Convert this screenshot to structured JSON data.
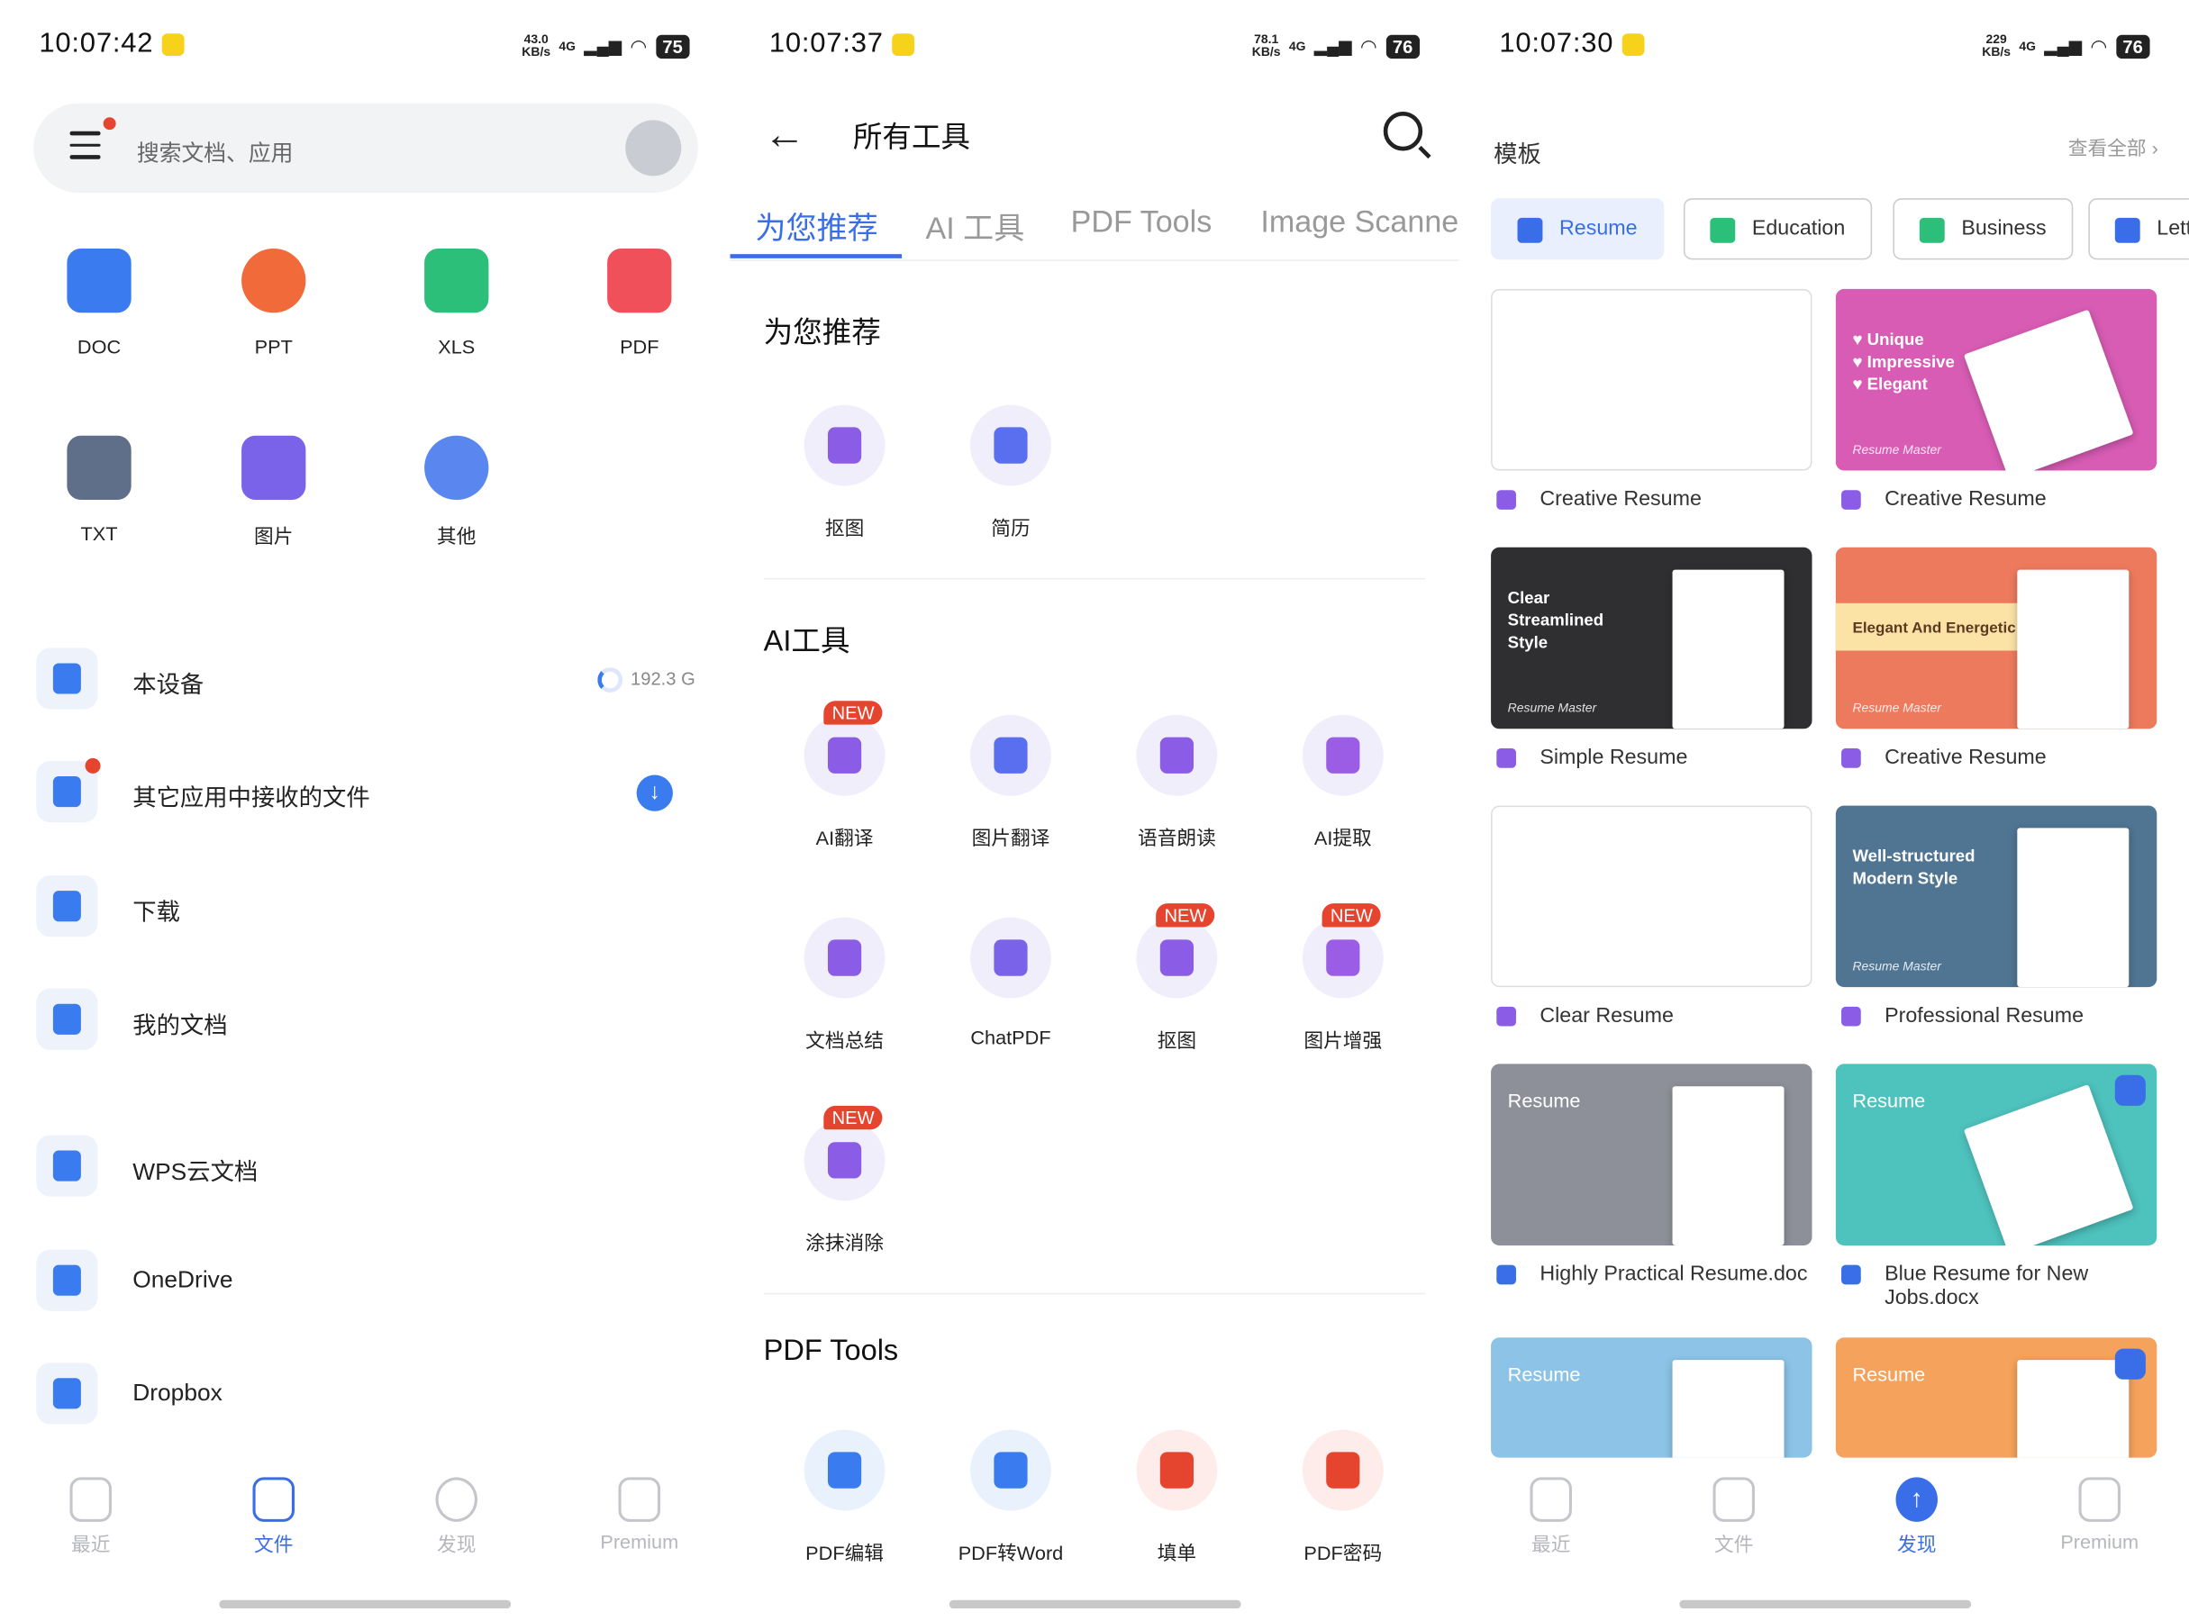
{
  "panel1": {
    "status": {
      "time": "10:07:42",
      "speed_top": "43.0",
      "speed_bottom": "KB/s",
      "network": "4G",
      "battery": "75"
    },
    "search": {
      "placeholder": "搜索文档、应用"
    },
    "grid": [
      {
        "label": "DOC",
        "icon": "doc-icon",
        "color": "#3a7cf0"
      },
      {
        "label": "PPT",
        "icon": "ppt-icon",
        "color": "#f06a3a"
      },
      {
        "label": "XLS",
        "icon": "xls-icon",
        "color": "#2cbf7a"
      },
      {
        "label": "PDF",
        "icon": "pdf-icon",
        "color": "#f0505a"
      },
      {
        "label": "TXT",
        "icon": "txt-icon",
        "color": "#5f6f8a"
      },
      {
        "label": "图片",
        "icon": "image-icon",
        "color": "#7a63e8"
      },
      {
        "label": "其他",
        "icon": "more-icon",
        "color": "#5a86f0"
      }
    ],
    "locations": [
      {
        "label": "本设备",
        "right": "192.3 G",
        "icon": "phone-icon"
      },
      {
        "label": "其它应用中接收的文件",
        "icon": "received-files-icon"
      },
      {
        "label": "下载",
        "icon": "download-icon"
      },
      {
        "label": "我的文档",
        "icon": "folder-icon"
      },
      {
        "label": "WPS云文档",
        "icon": "wps-cloud-icon"
      },
      {
        "label": "OneDrive",
        "icon": "onedrive-icon"
      },
      {
        "label": "Dropbox",
        "icon": "dropbox-icon"
      }
    ],
    "nav": [
      {
        "label": "最近",
        "icon": "recent-icon"
      },
      {
        "label": "文件",
        "icon": "files-icon",
        "active": true
      },
      {
        "label": "发现",
        "icon": "compass-icon"
      },
      {
        "label": "Premium",
        "icon": "premium-icon"
      }
    ]
  },
  "panel2": {
    "status": {
      "time": "10:07:37",
      "speed_top": "78.1",
      "speed_bottom": "KB/s",
      "network": "4G",
      "battery": "76"
    },
    "title": "所有工具",
    "tabs": [
      "为您推荐",
      "AI 工具",
      "PDF Tools",
      "Image Scanne"
    ],
    "sections": {
      "recommended": {
        "title": "为您推荐",
        "tools": [
          {
            "label": "抠图",
            "icon": "cutout-icon"
          },
          {
            "label": "简历",
            "icon": "resume-icon"
          }
        ]
      },
      "ai": {
        "title": "AI工具",
        "tools": [
          {
            "label": "AI翻译",
            "icon": "ai-translate-icon",
            "new": "NEW"
          },
          {
            "label": "图片翻译",
            "icon": "image-translate-icon"
          },
          {
            "label": "语音朗读",
            "icon": "headphones-icon"
          },
          {
            "label": "AI提取",
            "icon": "ai-extract-icon"
          },
          {
            "label": "文档总结",
            "icon": "summary-icon"
          },
          {
            "label": "ChatPDF",
            "icon": "chatpdf-icon"
          },
          {
            "label": "抠图",
            "icon": "cutout-icon",
            "new": "NEW"
          },
          {
            "label": "图片增强",
            "icon": "image-enhance-icon",
            "new": "NEW"
          },
          {
            "label": "涂抹消除",
            "icon": "eraser-icon",
            "new": "NEW"
          }
        ]
      },
      "pdf": {
        "title": "PDF Tools",
        "tools": [
          {
            "label": "PDF编辑",
            "icon": "pdf-edit-icon"
          },
          {
            "label": "PDF转Word",
            "icon": "pdf-to-word-icon"
          },
          {
            "label": "填单",
            "icon": "fill-form-icon"
          },
          {
            "label": "PDF密码",
            "icon": "pdf-lock-icon"
          }
        ]
      }
    }
  },
  "panel3": {
    "status": {
      "time": "10:07:30",
      "speed_top": "229",
      "speed_bottom": "KB/s",
      "network": "4G",
      "battery": "76"
    },
    "title": "模板",
    "view_all": "查看全部",
    "chips": [
      {
        "label": "Resume",
        "active": true
      },
      {
        "label": "Education"
      },
      {
        "label": "Business"
      },
      {
        "label": "Letter"
      }
    ],
    "cards": [
      {
        "label": "Creative Resume",
        "thumb_text": "",
        "thumb_sub": ""
      },
      {
        "label": "Creative Resume",
        "thumb_text": "♥ Unique\n♥ Impressive\n♥ Elegant",
        "thumb_sub": "Resume Master"
      },
      {
        "label": "Simple Resume",
        "thumb_text": "Clear\nStreamlined\nStyle",
        "thumb_sub": "Resume Master"
      },
      {
        "label": "Creative Resume",
        "thumb_text": "Elegant And Energetic",
        "thumb_sub": "Resume Master"
      },
      {
        "label": "Clear Resume",
        "thumb_text": "",
        "thumb_sub": ""
      },
      {
        "label": "Professional Resume",
        "thumb_text": "Well-structured\nModern Style",
        "thumb_sub": "Resume Master"
      },
      {
        "label": "Highly Practical Resume.doc",
        "thumb_text": "Resume",
        "thumb_sub": ""
      },
      {
        "label": "Blue Resume for New Jobs.docx",
        "thumb_text": "Resume",
        "thumb_sub": ""
      },
      {
        "label": "",
        "thumb_text": "Resume",
        "thumb_sub": ""
      },
      {
        "label": "",
        "thumb_text": "Resume",
        "thumb_sub": ""
      }
    ],
    "nav": [
      {
        "label": "最近",
        "icon": "recent-icon"
      },
      {
        "label": "文件",
        "icon": "files-icon"
      },
      {
        "label": "发现",
        "icon": "discover-icon",
        "active": true
      },
      {
        "label": "Premium",
        "icon": "premium-icon"
      }
    ],
    "colors": {
      "accent": "#3a6ee8",
      "new_badge": "#e5452e"
    }
  }
}
